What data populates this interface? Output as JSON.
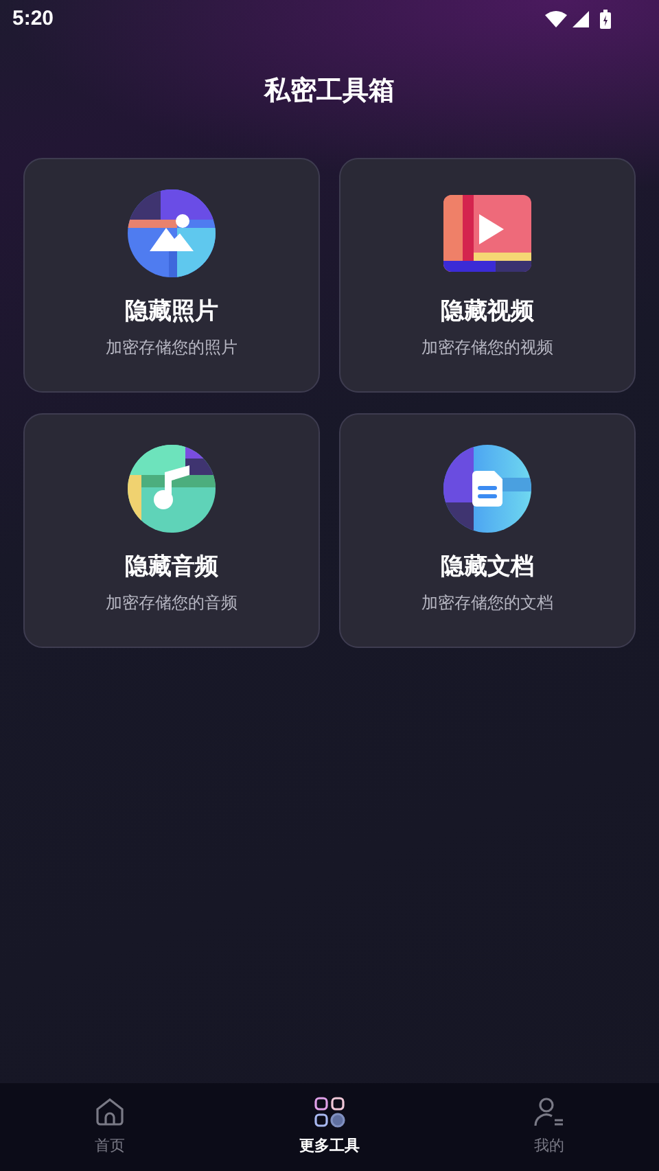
{
  "status_bar": {
    "time": "5:20"
  },
  "title": "私密工具箱",
  "tools": [
    {
      "kind": "photo",
      "name": "隐藏照片",
      "description": "加密存储您的照片"
    },
    {
      "kind": "video",
      "name": "隐藏视频",
      "description": "加密存储您的视频"
    },
    {
      "kind": "audio",
      "name": "隐藏音频",
      "description": "加密存储您的音频"
    },
    {
      "kind": "document",
      "name": "隐藏文档",
      "description": "加密存储您的文档"
    }
  ],
  "nav": [
    {
      "kind": "home",
      "label": "首页",
      "selected": false
    },
    {
      "kind": "tools",
      "label": "更多工具",
      "selected": true
    },
    {
      "kind": "profile",
      "label": "我的",
      "selected": false
    }
  ]
}
